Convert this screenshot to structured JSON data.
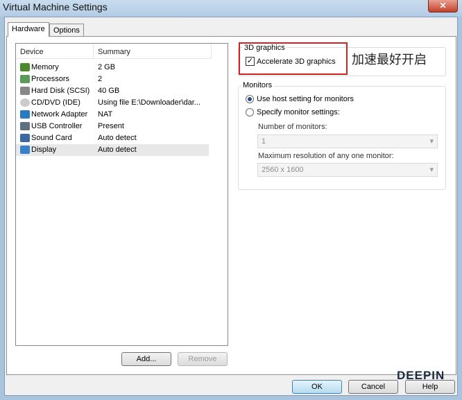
{
  "window": {
    "title": "Virtual Machine Settings",
    "close": "✕"
  },
  "tabs": [
    {
      "label": "Hardware"
    },
    {
      "label": "Options"
    }
  ],
  "devices": {
    "headers": [
      "Device",
      "Summary"
    ],
    "rows": [
      {
        "device": "Memory",
        "summary": "2 GB",
        "icon": "memory-icon",
        "color": "#4a8a2a"
      },
      {
        "device": "Processors",
        "summary": "2",
        "icon": "processor-icon",
        "color": "#5a9a5a"
      },
      {
        "device": "Hard Disk (SCSI)",
        "summary": "40 GB",
        "icon": "hard-disk-icon",
        "color": "#888888"
      },
      {
        "device": "CD/DVD (IDE)",
        "summary": "Using file E:\\Downloader\\dar...",
        "icon": "cd-dvd-icon",
        "color": "#cccccc"
      },
      {
        "device": "Network Adapter",
        "summary": "NAT",
        "icon": "network-adapter-icon",
        "color": "#2a7ac0"
      },
      {
        "device": "USB Controller",
        "summary": "Present",
        "icon": "usb-icon",
        "color": "#607080"
      },
      {
        "device": "Sound Card",
        "summary": "Auto detect",
        "icon": "sound-card-icon",
        "color": "#3a6aa0"
      },
      {
        "device": "Display",
        "summary": "Auto detect",
        "icon": "display-icon",
        "color": "#3a80c8"
      }
    ],
    "selected": 7
  },
  "buttons": {
    "add": "Add...",
    "remove": "Remove",
    "ok": "OK",
    "cancel": "Cancel",
    "help": "Help"
  },
  "graphics": {
    "group": "3D graphics",
    "accelerate": "Accelerate 3D graphics",
    "checked": true
  },
  "annotation": "加速最好开启",
  "monitors": {
    "group": "Monitors",
    "use_host": "Use host setting for monitors",
    "specify": "Specify monitor settings:",
    "number_label": "Number of monitors:",
    "number_value": "1",
    "maxres_label": "Maximum resolution of any one monitor:",
    "maxres_value": "2560 x 1600"
  },
  "watermark": "DEEPIN"
}
